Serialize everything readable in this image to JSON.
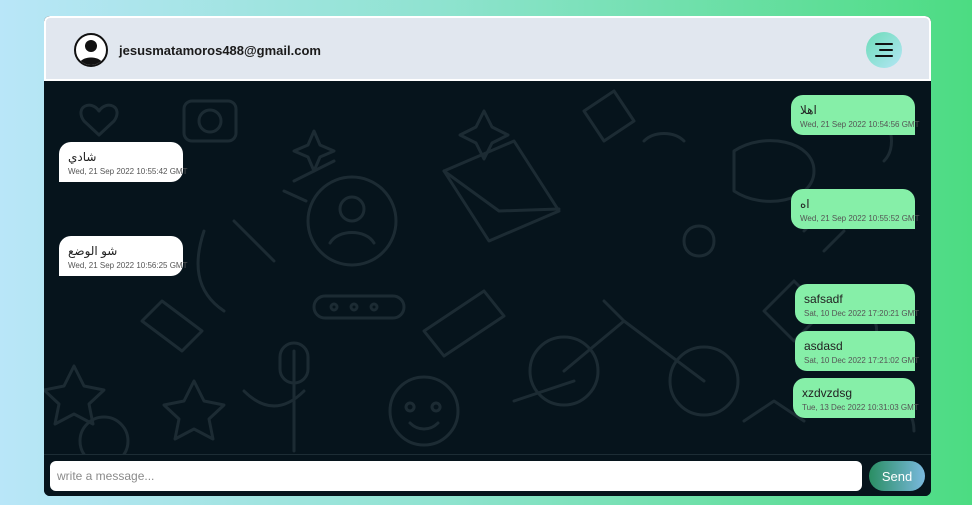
{
  "header": {
    "user_email": "jesusmatamoros488@gmail.com",
    "avatar_icon": "user-avatar-icon",
    "menu_icon": "hamburger-menu-icon"
  },
  "messages": [
    {
      "direction": "out",
      "text": "اهلا",
      "time": "Wed, 21 Sep 2022 10:54:56 GMT"
    },
    {
      "direction": "in",
      "text": "شادي",
      "time": "Wed, 21 Sep 2022 10:55:42 GMT"
    },
    {
      "direction": "out",
      "text": "اه",
      "time": "Wed, 21 Sep 2022 10:55:52 GMT"
    },
    {
      "direction": "in",
      "text": "شو الوضع",
      "time": "Wed, 21 Sep 2022 10:56:25 GMT"
    },
    {
      "direction": "out",
      "text": "safsadf",
      "time": "Sat, 10 Dec 2022 17:20:21 GMT"
    },
    {
      "direction": "out",
      "text": "asdasd",
      "time": "Sat, 10 Dec 2022 17:21:02 GMT"
    },
    {
      "direction": "out",
      "text": "xzdvzdsg",
      "time": "Tue, 13 Dec 2022 10:31:03 GMT"
    }
  ],
  "composer": {
    "value": "",
    "placeholder": "write a message...",
    "send_label": "Send"
  },
  "colors": {
    "chat_background": "#06141c",
    "outgoing_bubble": "#86efa8",
    "incoming_bubble": "#ffffff",
    "header_background": "#e1e7ef"
  }
}
